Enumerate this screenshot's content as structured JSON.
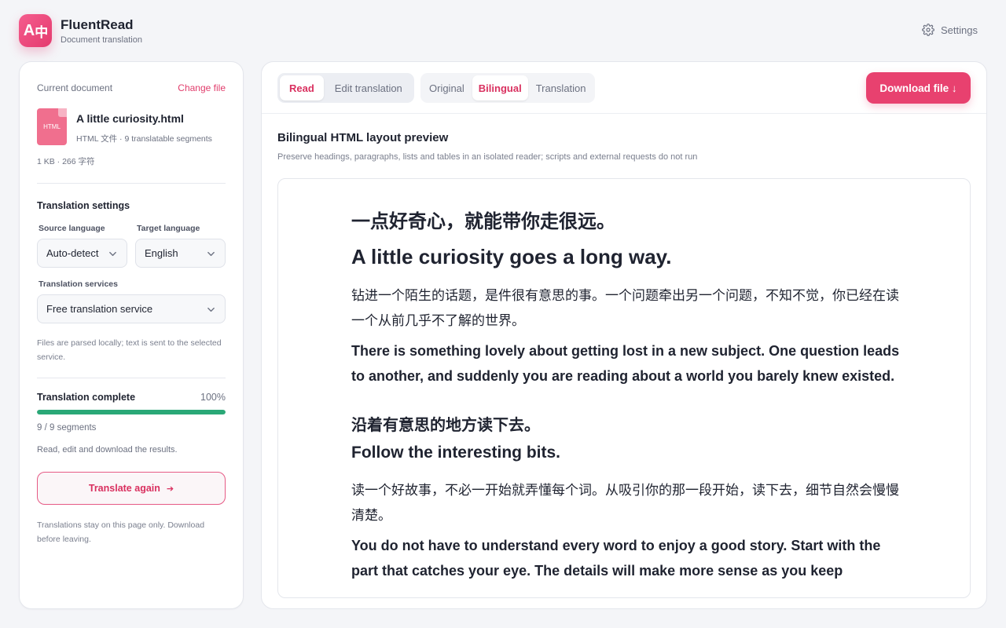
{
  "app": {
    "logo_text_latin": "A",
    "logo_text_zh": "中",
    "title": "FluentRead",
    "subtitle": "Document translation",
    "settings_label": "Settings"
  },
  "sidebar": {
    "current_document_label": "Current document",
    "change_file_label": "Change file",
    "file": {
      "type_badge": "HTML",
      "name": "A little curiosity.html",
      "meta": "HTML 文件 · 9 translatable segments",
      "size": "1 KB · 266 字符"
    },
    "settings_title": "Translation settings",
    "source_language_label": "Source language",
    "source_language_value": "Auto-detect",
    "target_language_label": "Target language",
    "target_language_value": "English",
    "services_label": "Translation services",
    "services_value": "Free translation service",
    "privacy_hint": "Files are parsed locally; text is sent to the selected service.",
    "progress_title": "Translation complete",
    "progress_percent_text": "100%",
    "progress_fraction": 1.0,
    "segments_text": "9 / 9 segments",
    "result_hint": "Read, edit and download the results.",
    "translate_again_label": "Translate again",
    "translate_again_arrow": "➔",
    "footer_hint": "Translations stay on this page only. Download before leaving."
  },
  "toolbar": {
    "mode_tabs": [
      {
        "label": "Read",
        "active": true
      },
      {
        "label": "Edit translation",
        "active": false
      }
    ],
    "view_tabs": [
      {
        "label": "Original",
        "active": false
      },
      {
        "label": "Bilingual",
        "active": true
      },
      {
        "label": "Translation",
        "active": false
      }
    ],
    "download_label": "Download file ↓"
  },
  "preview": {
    "title": "Bilingual HTML layout preview",
    "subtitle": "Preserve headings, paragraphs, lists and tables in an isolated reader; scripts and external requests do not run"
  },
  "reader": {
    "heading1_zh": "一点好奇心，就能带你走很远。",
    "heading1_en": "A little curiosity goes a long way.",
    "para1_zh": "钻进一个陌生的话题，是件很有意思的事。一个问题牵出另一个问题，不知不觉，你已经在读一个从前几乎不了解的世界。",
    "para1_en": "There is something lovely about getting lost in a new subject. One question leads to another, and suddenly you are reading about a world you barely knew existed.",
    "heading2_zh": "沿着有意思的地方读下去。",
    "heading2_en": "Follow the interesting bits.",
    "para2_zh": "读一个好故事，不必一开始就弄懂每个词。从吸引你的那一段开始，读下去，细节自然会慢慢清楚。",
    "para2_en": "You do not have to understand every word to enjoy a good story. Start with the part that catches your eye. The details will make more sense as you keep"
  },
  "colors": {
    "accent": "#e8416f",
    "progress": "#2aa877"
  }
}
